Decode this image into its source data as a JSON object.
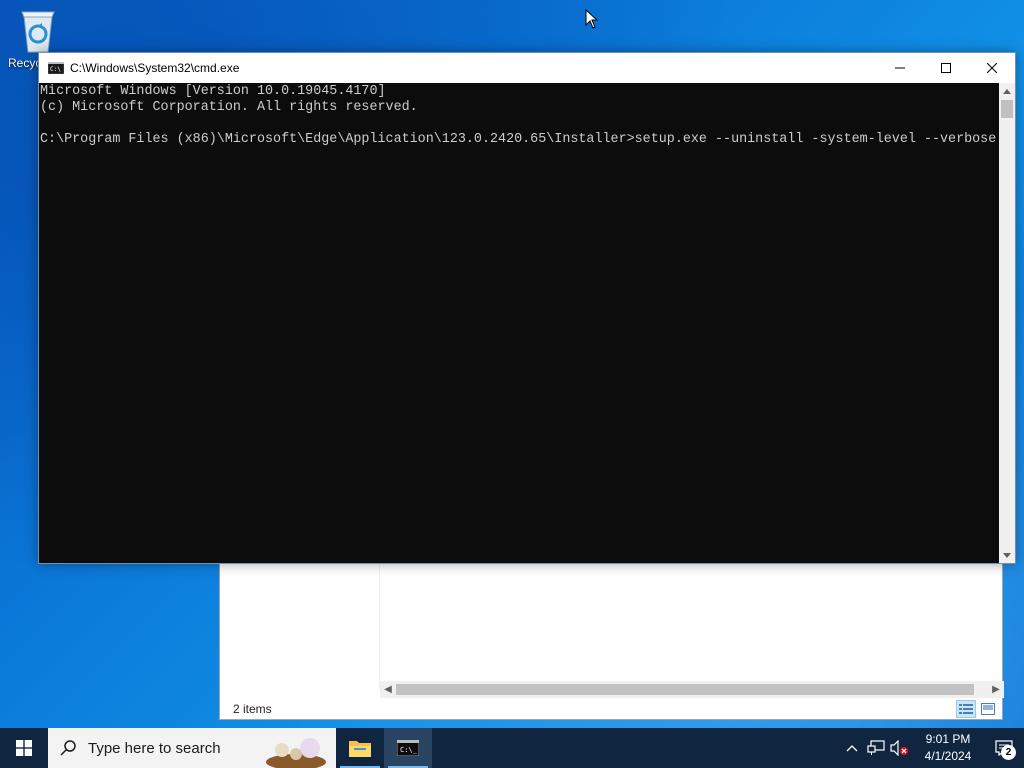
{
  "desktop": {
    "icons": [
      {
        "label": "Recyc",
        "icon": "recycle-bin-icon"
      }
    ]
  },
  "explorer": {
    "status_text": "2 items"
  },
  "cmd": {
    "title": "C:\\Windows\\System32\\cmd.exe",
    "lines": [
      "Microsoft Windows [Version 10.0.19045.4170]",
      "(c) Microsoft Corporation. All rights reserved.",
      "",
      "C:\\Program Files (x86)\\Microsoft\\Edge\\Application\\123.0.2420.65\\Installer>setup.exe --uninstall -system-level --verbose"
    ],
    "background_color": "#0c0c0c",
    "text_color": "#cccccc"
  },
  "taskbar": {
    "search_placeholder": "Type here to search",
    "time": "9:01 PM",
    "date": "4/1/2024",
    "notification_count": "2",
    "apps": [
      "file-explorer-icon",
      "command-prompt-icon"
    ]
  }
}
